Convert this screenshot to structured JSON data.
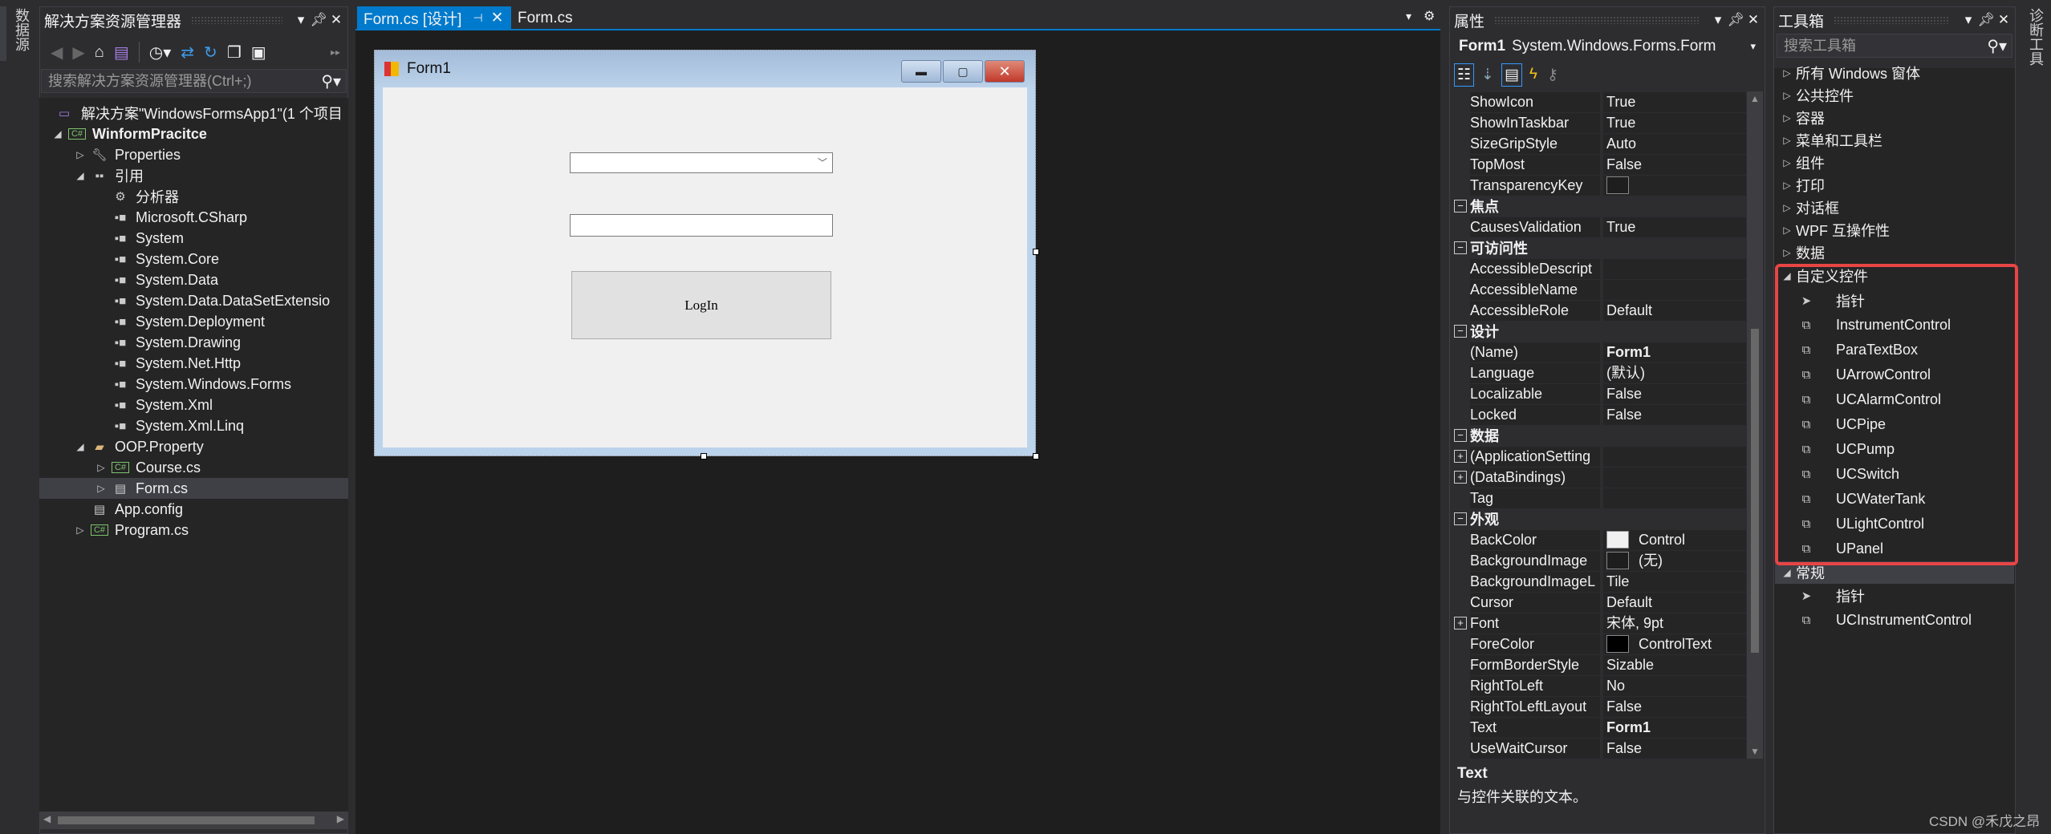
{
  "left_strip": {
    "tab": "数据源"
  },
  "right_strip": {
    "tab": "诊断工具"
  },
  "solution_explorer": {
    "title": "解决方案资源管理器",
    "search_placeholder": "搜索解决方案资源管理器(Ctrl+;)",
    "toolbar_icons": [
      "back-icon",
      "forward-icon",
      "home-icon",
      "vs-solution-icon",
      "history-icon",
      "sync-icon",
      "refresh-icon",
      "collapse-all-icon",
      "show-all-files-icon"
    ],
    "tree": [
      {
        "label": "解决方案\"WindowsFormsApp1\"(1 个项目",
        "depth": 0,
        "expander": "none",
        "icon": "solution-icon"
      },
      {
        "label": "WinformPracitce",
        "depth": 0,
        "expander": "expanded",
        "icon": "csharp-project-icon",
        "bold": true
      },
      {
        "label": "Properties",
        "depth": 1,
        "expander": "collapsed",
        "icon": "wrench-icon"
      },
      {
        "label": "引用",
        "depth": 1,
        "expander": "expanded",
        "icon": "references-icon"
      },
      {
        "label": "分析器",
        "depth": 2,
        "expander": "none",
        "icon": "analyzer-icon"
      },
      {
        "label": "Microsoft.CSharp",
        "depth": 2,
        "expander": "none",
        "icon": "reference-icon"
      },
      {
        "label": "System",
        "depth": 2,
        "expander": "none",
        "icon": "reference-icon"
      },
      {
        "label": "System.Core",
        "depth": 2,
        "expander": "none",
        "icon": "reference-icon"
      },
      {
        "label": "System.Data",
        "depth": 2,
        "expander": "none",
        "icon": "reference-icon"
      },
      {
        "label": "System.Data.DataSetExtensio",
        "depth": 2,
        "expander": "none",
        "icon": "reference-icon"
      },
      {
        "label": "System.Deployment",
        "depth": 2,
        "expander": "none",
        "icon": "reference-icon"
      },
      {
        "label": "System.Drawing",
        "depth": 2,
        "expander": "none",
        "icon": "reference-icon"
      },
      {
        "label": "System.Net.Http",
        "depth": 2,
        "expander": "none",
        "icon": "reference-icon"
      },
      {
        "label": "System.Windows.Forms",
        "depth": 2,
        "expander": "none",
        "icon": "reference-icon"
      },
      {
        "label": "System.Xml",
        "depth": 2,
        "expander": "none",
        "icon": "reference-icon"
      },
      {
        "label": "System.Xml.Linq",
        "depth": 2,
        "expander": "none",
        "icon": "reference-icon"
      },
      {
        "label": "OOP.Property",
        "depth": 1,
        "expander": "expanded",
        "icon": "folder-icon"
      },
      {
        "label": "Course.cs",
        "depth": 2,
        "expander": "collapsed",
        "icon": "csharp-file-icon"
      },
      {
        "label": "Form.cs",
        "depth": 2,
        "expander": "collapsed",
        "icon": "form-icon",
        "selected": true
      },
      {
        "label": "App.config",
        "depth": 1,
        "expander": "none",
        "icon": "config-icon"
      },
      {
        "label": "Program.cs",
        "depth": 1,
        "expander": "collapsed",
        "icon": "csharp-file-icon"
      }
    ]
  },
  "document": {
    "tabs": [
      {
        "label": "Form.cs [设计]",
        "active": true
      },
      {
        "label": "Form.cs",
        "active": false
      }
    ],
    "form": {
      "title": "Form1",
      "button_label": "LogIn",
      "combobox_value": "",
      "textbox_value": ""
    }
  },
  "properties": {
    "title": "属性",
    "object_name": "Form1",
    "object_type": "System.Windows.Forms.Form",
    "toolbar_icons": [
      "categorized-icon",
      "alphabetical-icon",
      "properties-icon",
      "events-icon",
      "property-pages-icon"
    ],
    "rows": [
      {
        "name": "ShowIcon",
        "value": "True"
      },
      {
        "name": "ShowInTaskbar",
        "value": "True"
      },
      {
        "name": "SizeGripStyle",
        "value": "Auto"
      },
      {
        "name": "TopMost",
        "value": "False"
      },
      {
        "name": "TransparencyKey",
        "value": "",
        "swatch": "#1e1e1e"
      },
      {
        "category": "焦点"
      },
      {
        "name": "CausesValidation",
        "value": "True"
      },
      {
        "category": "可访问性"
      },
      {
        "name": "AccessibleDescript",
        "value": ""
      },
      {
        "name": "AccessibleName",
        "value": ""
      },
      {
        "name": "AccessibleRole",
        "value": "Default"
      },
      {
        "category": "设计"
      },
      {
        "name": "(Name)",
        "value": "Form1",
        "bold": true
      },
      {
        "name": "Language",
        "value": "(默认)"
      },
      {
        "name": "Localizable",
        "value": "False"
      },
      {
        "name": "Locked",
        "value": "False"
      },
      {
        "category": "数据"
      },
      {
        "name": "(ApplicationSetting",
        "value": "",
        "expandable": true
      },
      {
        "name": "(DataBindings)",
        "value": "",
        "expandable": true
      },
      {
        "name": "Tag",
        "value": ""
      },
      {
        "category": "外观"
      },
      {
        "name": "BackColor",
        "value": "Control",
        "swatch": "#f0f0f0"
      },
      {
        "name": "BackgroundImage",
        "value": "(无)",
        "swatch": "#1e1e1e"
      },
      {
        "name": "BackgroundImageL",
        "value": "Tile"
      },
      {
        "name": "Cursor",
        "value": "Default"
      },
      {
        "name": "Font",
        "value": "宋体, 9pt",
        "expandable": true
      },
      {
        "name": "ForeColor",
        "value": "ControlText",
        "swatch": "#000000"
      },
      {
        "name": "FormBorderStyle",
        "value": "Sizable"
      },
      {
        "name": "RightToLeft",
        "value": "No"
      },
      {
        "name": "RightToLeftLayout",
        "value": "False"
      },
      {
        "name": "Text",
        "value": "Form1",
        "bold": true
      },
      {
        "name": "UseWaitCursor",
        "value": "False"
      }
    ],
    "description_title": "Text",
    "description_text": "与控件关联的文本。"
  },
  "toolbox": {
    "title": "工具箱",
    "search_placeholder": "搜索工具箱",
    "categories": [
      "所有 Windows 窗体",
      "公共控件",
      "容器",
      "菜单和工具栏",
      "组件",
      "打印",
      "对话框",
      "WPF 互操作性",
      "数据"
    ],
    "custom_group": {
      "label": "自定义控件",
      "items": [
        "指针",
        "InstrumentControl",
        "ParaTextBox",
        "UArrowControl",
        "UCAlarmControl",
        "UCPipe",
        "UCPump",
        "UCSwitch",
        "UCWaterTank",
        "ULightControl",
        "UPanel"
      ]
    },
    "general_group": {
      "label": "常规",
      "items": [
        "指针",
        "UCInstrumentControl"
      ]
    },
    "highlight_color": "#e84545"
  },
  "watermark": "CSDN @禾戊之昂",
  "colors": {
    "accent": "#007acc",
    "panel": "#2d2d30",
    "tree_bg": "#252526",
    "editor_bg": "#1e1e1e"
  }
}
